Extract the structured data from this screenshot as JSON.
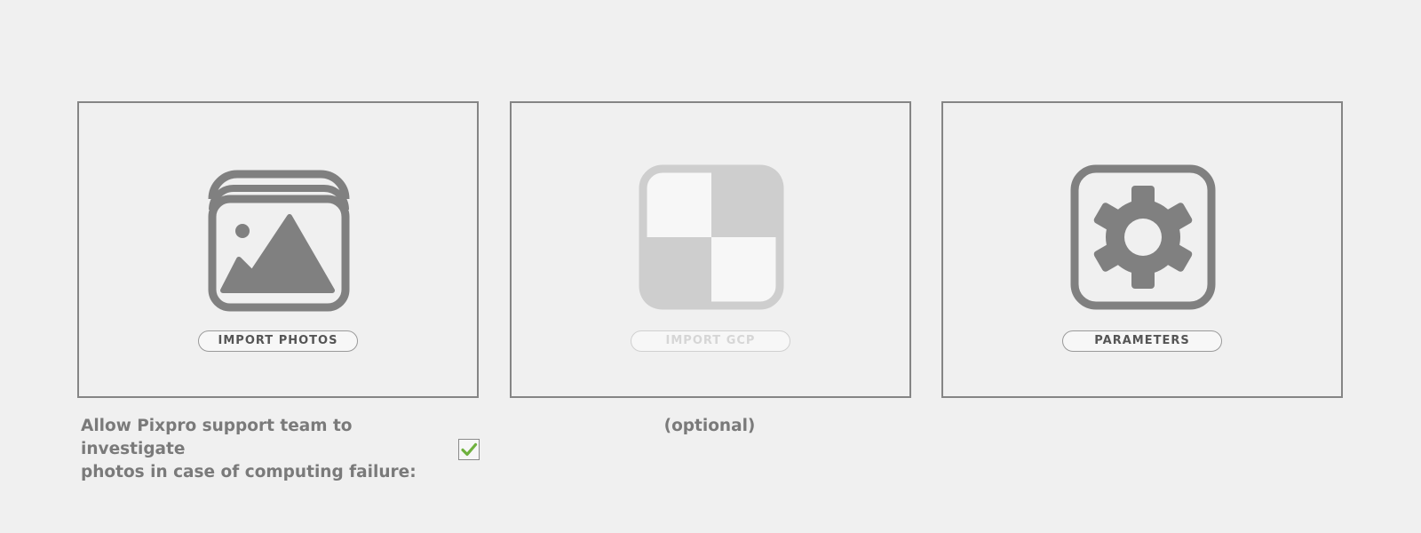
{
  "cards": {
    "import_photos": {
      "label": "IMPORT PHOTOS",
      "icon": "photos-stack-icon",
      "enabled": true
    },
    "import_gcp": {
      "label": "IMPORT GCP",
      "icon": "checkerboard-target-icon",
      "enabled": false,
      "note": "(optional)"
    },
    "parameters": {
      "label": "PARAMETERS",
      "icon": "gear-icon",
      "enabled": true
    }
  },
  "consent": {
    "line1": "Allow Pixpro support team to investigate",
    "line2": "photos in case of computing failure:",
    "checked": true
  },
  "colors": {
    "background": "#f0f0f0",
    "border": "#858585",
    "icon": "#808080",
    "icon_disabled": "#cecece",
    "text": "#7a7a7a",
    "check": "#6fb13e"
  }
}
